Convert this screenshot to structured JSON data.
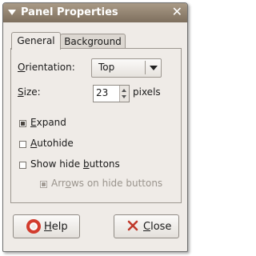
{
  "window": {
    "title": "Panel Properties"
  },
  "tabs": [
    {
      "label": "General",
      "active": true
    },
    {
      "label": "Background",
      "active": false
    }
  ],
  "orientation": {
    "label_pre": "",
    "label_u": "O",
    "label_post": "rientation:",
    "value": "Top"
  },
  "size": {
    "label_pre": "",
    "label_u": "S",
    "label_post": "ize:",
    "value": "23",
    "unit": "pixels"
  },
  "options": {
    "expand": {
      "pre": "",
      "u": "E",
      "post": "xpand",
      "checked": true
    },
    "autohide": {
      "pre": "",
      "u": "A",
      "post": "utohide",
      "checked": false
    },
    "show_hide_buttons": {
      "pre": "Show hide ",
      "u": "b",
      "post": "uttons",
      "checked": false
    },
    "arrows_on_hide_buttons": {
      "pre": "Arr",
      "u": "o",
      "post": "ws on hide buttons",
      "checked": true,
      "disabled": true
    }
  },
  "buttons": {
    "help": {
      "pre": "",
      "u": "H",
      "post": "elp"
    },
    "close": {
      "pre": "",
      "u": "C",
      "post": "lose"
    }
  },
  "icons": {
    "window_menu": "chevron-down-icon",
    "close": "close-icon",
    "help": "lifebuoy-icon",
    "close_button": "close-icon",
    "combo": "dropdown-arrow-icon"
  },
  "colors": {
    "titlebar": "#8f7f6c",
    "window_bg": "#efebe7",
    "help_icon": "#d23c2e",
    "close_icon": "#c0392b"
  }
}
